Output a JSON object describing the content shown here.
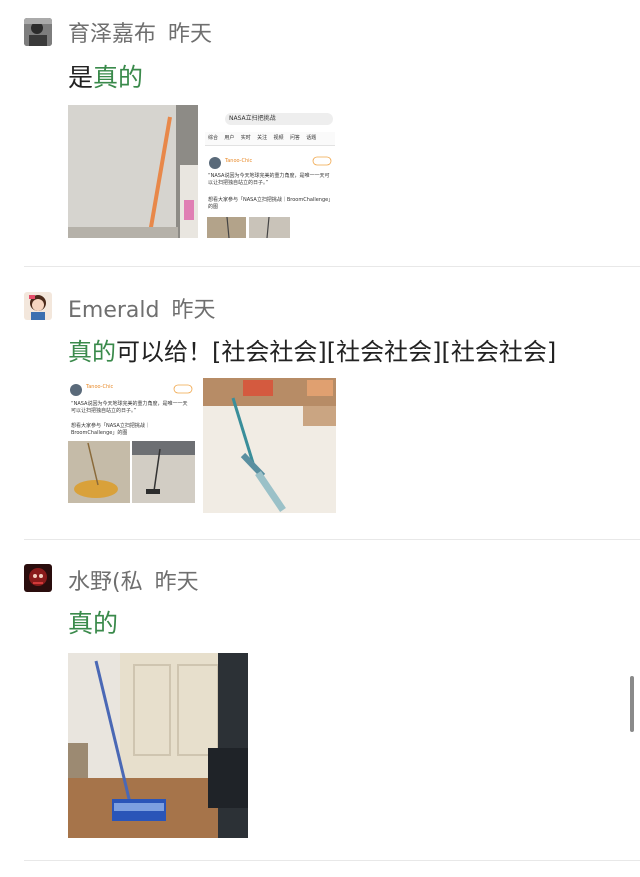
{
  "comments": [
    {
      "author": "育泽嘉布",
      "time": "昨天",
      "text_highlight": "",
      "text_pre": "是",
      "text_green": "真的",
      "text_post": "",
      "screenshot": {
        "search_query": "NASA立扫把挑战",
        "tabs": [
          "综合",
          "用户",
          "实时",
          "关注",
          "视频",
          "问答",
          "话题"
        ],
        "user": "Tanoo-Chic",
        "post_line1": "“NASA说因为今天地球完美的重力角度，是唯一一天可以让扫把独自站立的日子。”",
        "post_line2": "想看大家参与「NASA立扫把挑战｜BroomChallenge」的图"
      }
    },
    {
      "author": "Emerald",
      "time": "昨天",
      "text_pre": "",
      "text_green": "真的",
      "text_post": "可以给！[社会社会][社会社会][社会社会]",
      "screenshot": {
        "user": "Tanoo-Chic",
        "post_line1": "“NASA说因为今天地球完美的重力角度，是唯一一天可以让扫把独自站立的日子。”",
        "post_line2": "想看大家参与「NASA立扫把挑战｜BroomChallenge」的图"
      }
    },
    {
      "author": "水野(私",
      "time": "昨天",
      "text_pre": "",
      "text_green": "真的",
      "text_post": ""
    }
  ]
}
